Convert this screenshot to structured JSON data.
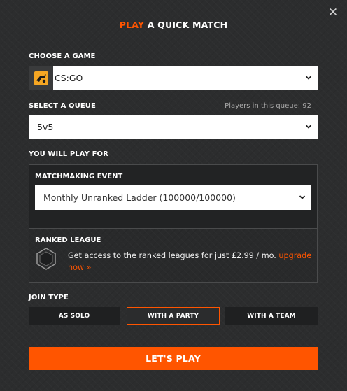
{
  "header": {
    "title_accent": "PLAY",
    "title_rest": " A QUICK MATCH",
    "close_icon": "close-icon"
  },
  "game": {
    "label": "CHOOSE A GAME",
    "selected": "CS:GO",
    "logo_icon": "csgo-logo-icon"
  },
  "queue": {
    "label": "SELECT A QUEUE",
    "players_info": "Players in this queue: 92",
    "selected": "5v5"
  },
  "play_for": {
    "label": "YOU WILL PLAY FOR",
    "matchmaking_label": "MATCHMAKING EVENT",
    "event_selected": "Monthly Unranked Ladder (100000/100000)",
    "ranked_label": "RANKED LEAGUE",
    "ranked_text": "Get access to the ranked leagues for just £2.99 / mo. ",
    "upgrade_link": "upgrade now »",
    "league_icon": "league-badge-icon"
  },
  "join_type": {
    "label": "JOIN TYPE",
    "options": [
      "AS SOLO",
      "WITH A PARTY",
      "WITH A TEAM"
    ],
    "selected": "WITH A PARTY"
  },
  "play_button": "LET'S PLAY",
  "colors": {
    "accent": "#ff5500",
    "background": "#2c2d2e",
    "button_dark": "#1f2021"
  }
}
